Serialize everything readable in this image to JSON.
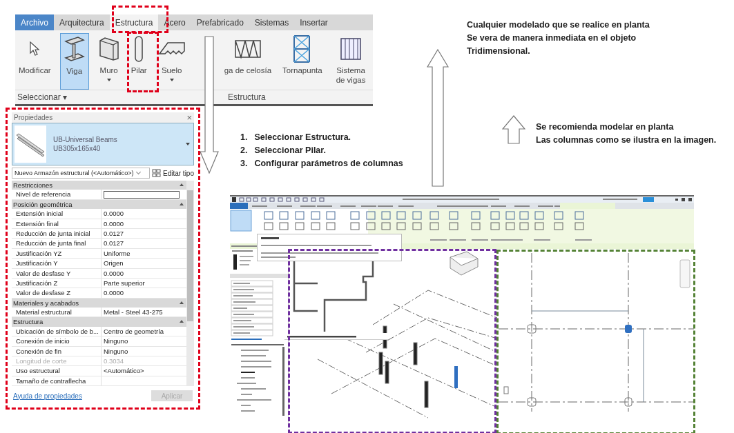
{
  "ribbon": {
    "tabs": [
      {
        "label": "Archivo",
        "selected": false,
        "kind": "file"
      },
      {
        "label": "Arquitectura",
        "selected": false,
        "kind": "tab"
      },
      {
        "label": "Estructura",
        "selected": true,
        "kind": "tab"
      },
      {
        "label": "Acero",
        "selected": false,
        "kind": "tab"
      },
      {
        "label": "Prefabricado",
        "selected": false,
        "kind": "tab"
      },
      {
        "label": "Sistemas",
        "selected": false,
        "kind": "tab"
      },
      {
        "label": "Insertar",
        "selected": false,
        "kind": "tab"
      }
    ],
    "tools": [
      {
        "label": "Modificar",
        "kind": "cursor",
        "selected": false,
        "dropdown": false
      },
      {
        "label": "Viga",
        "kind": "beam",
        "selected": true,
        "dropdown": false
      },
      {
        "label": "Muro",
        "kind": "wall",
        "selected": false,
        "dropdown": true
      },
      {
        "label": "Pilar",
        "kind": "column",
        "selected": false,
        "dropdown": false
      },
      {
        "label": "Suelo",
        "kind": "floor",
        "selected": false,
        "dropdown": true
      },
      {
        "label": "ga de celosía",
        "kind": "truss",
        "selected": false,
        "dropdown": false
      },
      {
        "label": "Tornapunta",
        "kind": "brace",
        "selected": false,
        "dropdown": false
      },
      {
        "label": "Sistema de vigas",
        "kind": "beamsystem",
        "selected": false,
        "dropdown": false
      }
    ],
    "panels": [
      "Seleccionar ▾",
      "Estructura"
    ]
  },
  "properties": {
    "title": "Propiedades",
    "close": "×",
    "type_family": "UB-Universal Beams",
    "type_name": "UB305x165x40",
    "instance_filter": "Nuevo Armazón estructural (<Automático>)",
    "edit_type": "Editar tipo",
    "groups": [
      {
        "label": "Restricciones",
        "rows": [
          {
            "name": "Nivel de referencia",
            "kind": "field",
            "disabled": false
          }
        ]
      },
      {
        "label": "Posición geométrica",
        "rows": [
          {
            "name": "Extensión inicial",
            "value": "0.0000",
            "kind": "text",
            "disabled": false
          },
          {
            "name": "Extensión final",
            "value": "0.0000",
            "kind": "text",
            "disabled": false
          },
          {
            "name": "Reducción de junta inicial",
            "value": "0.0127",
            "kind": "text",
            "disabled": false
          },
          {
            "name": "Reducción de junta final",
            "value": "0.0127",
            "kind": "text",
            "disabled": false
          },
          {
            "name": "Justificación YZ",
            "value": "Uniforme",
            "kind": "text",
            "disabled": false
          },
          {
            "name": "Justificación Y",
            "value": "Origen",
            "kind": "text",
            "disabled": false
          },
          {
            "name": "Valor de desfase Y",
            "value": "0.0000",
            "kind": "text",
            "disabled": false
          },
          {
            "name": "Justificación Z",
            "value": "Parte superior",
            "kind": "text",
            "disabled": false
          },
          {
            "name": "Valor de desfase Z",
            "value": "0.0000",
            "kind": "text",
            "disabled": false
          }
        ]
      },
      {
        "label": "Materiales y acabados",
        "rows": [
          {
            "name": "Material estructural",
            "value": "Metal - Steel 43-275",
            "kind": "text",
            "disabled": false
          }
        ]
      },
      {
        "label": "Estructura",
        "rows": [
          {
            "name": "Ubicación de símbolo de b...",
            "value": "Centro de geometría",
            "kind": "text",
            "disabled": false
          },
          {
            "name": "Conexión de inicio",
            "value": "Ninguno",
            "kind": "text",
            "disabled": false
          },
          {
            "name": "Conexión de fin",
            "value": "Ninguno",
            "kind": "text",
            "disabled": false
          },
          {
            "name": "Longitud de corte",
            "value": "0.3034",
            "kind": "text",
            "disabled": true
          },
          {
            "name": "Uso estructural",
            "value": "<Automático>",
            "kind": "text",
            "disabled": false
          },
          {
            "name": "Tamaño de contraflecha",
            "kind": "text",
            "disabled": false
          }
        ]
      }
    ],
    "help_link": "Ayuda de propiedades",
    "apply": "Aplicar",
    "apply_disabled": true
  },
  "steps": [
    {
      "number": "1.",
      "text": "Seleccionar Estructura."
    },
    {
      "number": "2.",
      "text": "Seleccionar Pilar."
    },
    {
      "number": "3.",
      "text": "Configurar parámetros de columnas"
    }
  ],
  "notes": [
    {
      "lines": [
        "Cualquier modelado que se realice en planta",
        "Se vera de manera inmediata en el objeto",
        "Tridimensional."
      ]
    },
    {
      "lines": [
        "Se recomienda modelar en planta",
        "Las columnas como se ilustra en la imagen."
      ]
    }
  ]
}
